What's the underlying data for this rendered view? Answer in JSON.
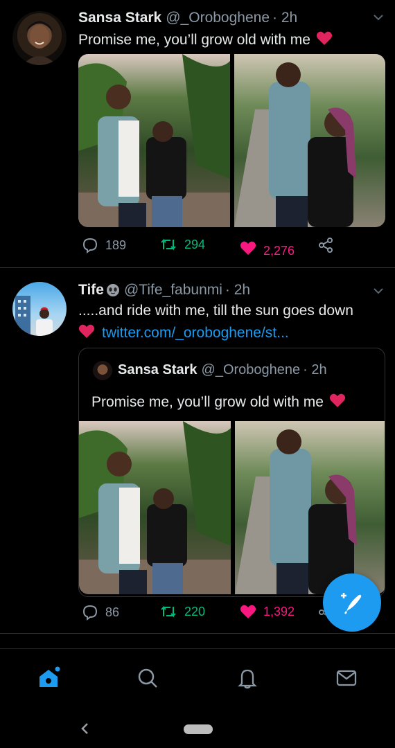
{
  "tweets": [
    {
      "author_name": "Sansa Stark",
      "author_handle": "@_Oroboghene",
      "time": "· 2h",
      "text": "Promise me, you’ll grow old with me",
      "emoji": "heart-icon",
      "actions": {
        "replies": "189",
        "retweets": "294",
        "likes": "2,276"
      }
    },
    {
      "author_name": "Tife",
      "author_emoji": "alien-face-icon",
      "author_handle": "@Tife_fabunmi",
      "time": "· 2h",
      "text_line1": ".....and ride with me, till the sun goes down",
      "link": "twitter.com/_oroboghene/st...",
      "quoted": {
        "author_name": "Sansa Stark",
        "author_handle": "@_Oroboghene",
        "time": "· 2h",
        "text": "Promise me, you’ll grow old with me"
      },
      "actions": {
        "replies": "86",
        "retweets": "220",
        "likes": "1,392"
      }
    }
  ],
  "colors": {
    "background": "#000000",
    "accent": "#1d9bf0",
    "retweet": "#00ba7c",
    "like": "#f91880",
    "secondary_text": "#8b98a5"
  },
  "nav": [
    "home-icon",
    "search-icon",
    "notifications-icon",
    "messages-icon"
  ],
  "system_nav": [
    "back-icon",
    "home-pill"
  ]
}
